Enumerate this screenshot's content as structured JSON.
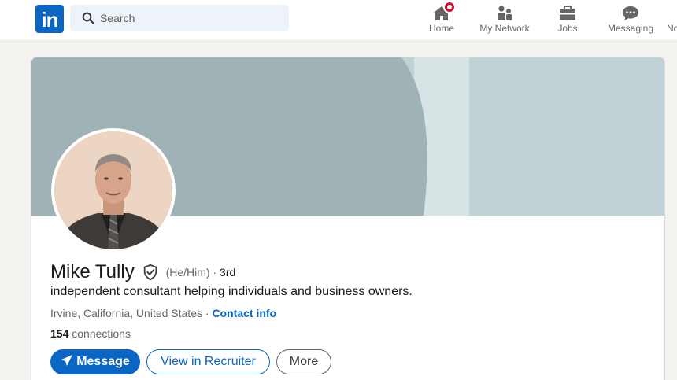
{
  "topnav": {
    "logo_text": "in",
    "search_placeholder": "Search",
    "items": [
      {
        "label": "Home",
        "icon": "home-icon"
      },
      {
        "label": "My Network",
        "icon": "network-icon"
      },
      {
        "label": "Jobs",
        "icon": "briefcase-icon"
      },
      {
        "label": "Messaging",
        "icon": "messaging-icon"
      },
      {
        "label": "No",
        "icon": "bell-icon"
      }
    ]
  },
  "profile": {
    "name": "Mike Tully",
    "pronouns": "(He/Him)",
    "degree_separator": " · ",
    "degree": "3rd",
    "headline": "independent consultant helping individuals and business owners.",
    "location": "Irvine, California, United States",
    "location_separator": " · ",
    "contact_info": "Contact info",
    "connections_count": "154",
    "connections_label": " connections"
  },
  "actions": {
    "message": "Message",
    "view_in_recruiter": "View in Recruiter",
    "more": "More"
  },
  "colors": {
    "brand": "#0a66c2",
    "notification": "#cb112d",
    "cover_dark": "#9fb2b5",
    "cover_light": "#bfd3d7"
  }
}
